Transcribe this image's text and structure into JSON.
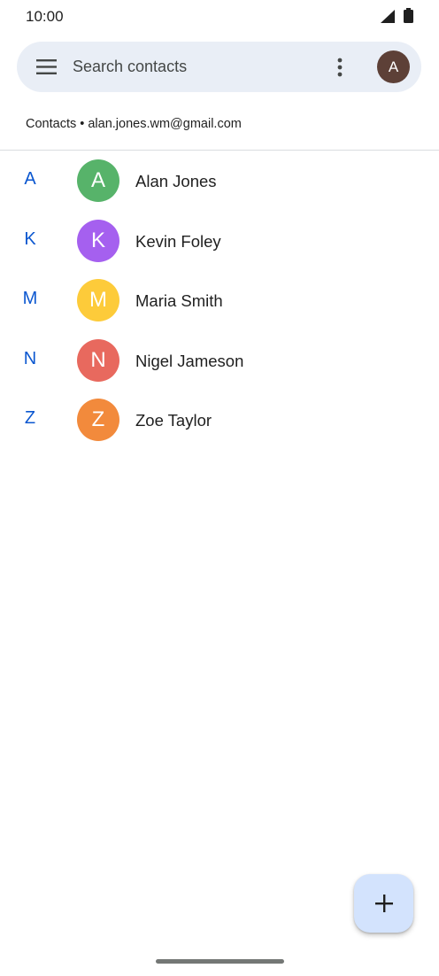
{
  "status_bar": {
    "time": "10:00",
    "icons": [
      "signal-icon",
      "battery-icon"
    ]
  },
  "search": {
    "placeholder": "Search contacts",
    "menu_icon": "menu-icon",
    "more_icon": "more-vert-icon",
    "avatar_letter": "A",
    "avatar_color": "#5d4037"
  },
  "account": {
    "label": "Contacts • alan.jones.wm@gmail.com"
  },
  "contacts": [
    {
      "section": "A",
      "initial": "A",
      "name": "Alan Jones",
      "color": "#57b36a"
    },
    {
      "section": "K",
      "initial": "K",
      "name": "Kevin Foley",
      "color": "#a560ef"
    },
    {
      "section": "M",
      "initial": "M",
      "name": "Maria Smith",
      "color": "#fdcb3a"
    },
    {
      "section": "N",
      "initial": "N",
      "name": "Nigel Jameson",
      "color": "#e8695e"
    },
    {
      "section": "Z",
      "initial": "Z",
      "name": "Zoe Taylor",
      "color": "#f28a3c"
    }
  ],
  "fab": {
    "icon": "plus-icon",
    "color": "#d3e3fd"
  },
  "colors": {
    "accent": "#0b57d0",
    "search_bg": "#e9eef6"
  }
}
